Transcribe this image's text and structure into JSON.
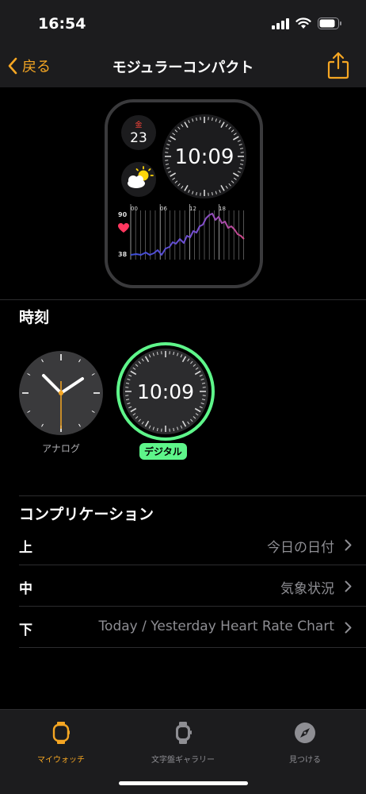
{
  "status": {
    "time": "16:54"
  },
  "nav": {
    "back_label": "戻る",
    "title": "モジュラーコンパクト"
  },
  "watch": {
    "date_weekday": "金",
    "date_day": "23",
    "time": "10:09",
    "chart_hours": [
      "00",
      "06",
      "12",
      "18"
    ],
    "chart_max": "90",
    "chart_min": "38"
  },
  "time_section": {
    "title": "時刻",
    "options": [
      {
        "label": "アナログ",
        "selected": false
      },
      {
        "label": "デジタル",
        "selected": true
      }
    ],
    "digital_time": "10:09"
  },
  "complications": {
    "title": "コンプリケーション",
    "rows": [
      {
        "label": "上",
        "value": "今日の日付"
      },
      {
        "label": "中",
        "value": "気象状況"
      },
      {
        "label": "下",
        "value": "Today / Yesterday Heart Rate Chart"
      }
    ]
  },
  "tabbar": {
    "items": [
      {
        "label": "マイウォッチ",
        "active": true
      },
      {
        "label": "文字盤ギャラリー",
        "active": false
      },
      {
        "label": "見つける",
        "active": false
      }
    ]
  },
  "colors": {
    "accent": "#f5a623",
    "selected_ring": "#5ef58a",
    "heart": "#ff375f"
  }
}
